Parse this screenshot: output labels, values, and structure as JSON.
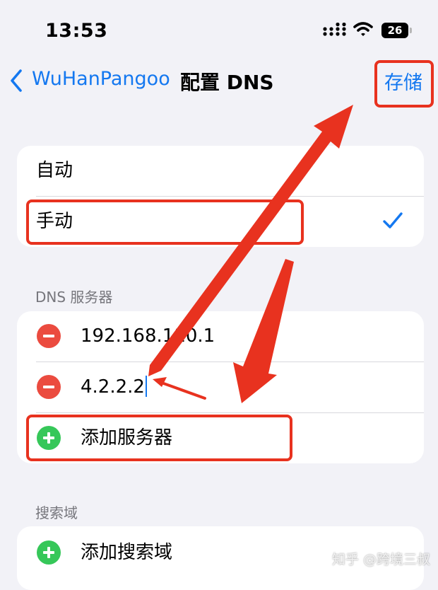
{
  "status_bar": {
    "time": "13:53",
    "battery": "26"
  },
  "nav": {
    "back_label": "WuHanPangoo",
    "title": "配置 DNS",
    "save_label": "存储"
  },
  "mode": {
    "automatic_label": "自动",
    "manual_label": "手动",
    "selected": "手动"
  },
  "dns": {
    "header": "DNS 服务器",
    "servers": [
      "192.168.110.1",
      "4.2.2.2"
    ],
    "add_server_label": "添加服务器"
  },
  "search_domains": {
    "header": "搜索域",
    "add_label": "添加搜索域"
  },
  "watermark": "知乎 @跨境三叔",
  "colors": {
    "accent": "#1478f0",
    "delete": "#eb4b3f",
    "add": "#36c759",
    "annotation": "#e8321f"
  }
}
